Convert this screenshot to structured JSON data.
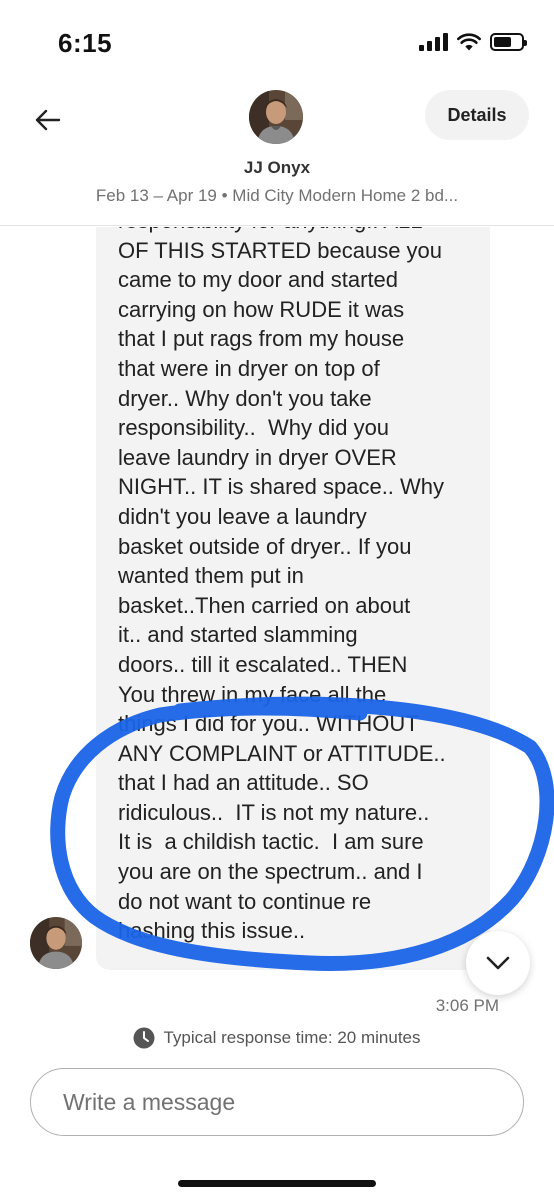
{
  "status_bar": {
    "time": "6:15",
    "icons": [
      "cellular-signal-icon",
      "wifi-icon",
      "battery-icon"
    ],
    "battery_level": 0.65
  },
  "header": {
    "back_icon": "arrow-left-icon",
    "details_label": "Details",
    "host_name": "JJ Onyx",
    "subtitle": "Feb 13 – Apr 19 • Mid City Modern Home 2 bd..."
  },
  "message": {
    "text": "responsibility for anything.. ALL\nOF THIS STARTED because you\ncame to my door and started\ncarrying on how RUDE it was\nthat I put rags from my house\nthat were in dryer on top of\ndryer.. Why don't you take\nresponsibility..  Why did you\nleave laundry in dryer OVER\nNIGHT.. IT is shared space.. Why\ndidn't you leave a laundry\nbasket outside of dryer.. If you\nwanted them put in\nbasket..Then carried on about\nit.. and started slamming\ndoors.. till it escalated.. THEN\nYou threw in my face all the\nthings I did for you.. WITHOUT\nANY COMPLAINT or ATTITUDE..\nthat I had an attitude.. SO\nridiculous..  IT is not my nature..\nIt is  a childish tactic.  I am sure\nyou are on the spectrum.. and I\ndo not want to continue re\nhashing this issue..",
    "timestamp": "3:06 PM"
  },
  "response_time": {
    "icon": "clock-icon",
    "text": "Typical response time: 20 minutes"
  },
  "composer": {
    "placeholder": "Write a message"
  },
  "colors": {
    "highlight": "#1a63e6",
    "bubble": "#f3f3f3",
    "muted_text": "#717171"
  }
}
